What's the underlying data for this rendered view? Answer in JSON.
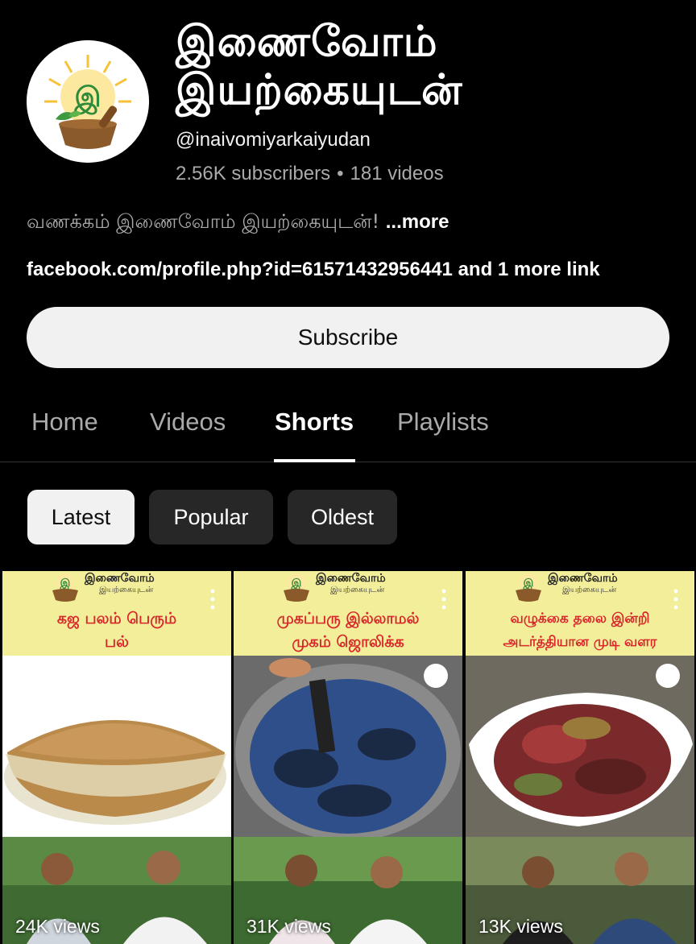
{
  "channel": {
    "name": "இணைவோம் இயற்கையுடன்",
    "handle": "@inaivomiyarkaiyudan",
    "subscribers": "2.56K subscribers",
    "videos": "181 videos",
    "separator": "•",
    "avatar_icon": "mortar-pestle-logo-icon"
  },
  "description": {
    "text": "வணக்கம்  இணைவோம் இயற்கையுடன்! ",
    "more": "...more"
  },
  "links": {
    "url": "facebook.com/profile.php?id=61571432956441",
    "more": " and 1 more link"
  },
  "subscribe": {
    "label": "Subscribe"
  },
  "tabs": [
    {
      "label": "Home"
    },
    {
      "label": "Videos"
    },
    {
      "label": "Shorts",
      "active": true
    },
    {
      "label": "Playlists"
    }
  ],
  "chips": [
    {
      "label": "Latest",
      "active": true
    },
    {
      "label": "Popular"
    },
    {
      "label": "Oldest"
    }
  ],
  "shorts": [
    {
      "title_line1": "கஜ பலம் பெரும்",
      "title_line2": "பல்",
      "views": "24K views",
      "photo": "spice-powder-bowl"
    },
    {
      "title_line1": "முகப்பரு இல்லாமல்",
      "title_line2": "முகம் ஜொலிக்க",
      "views": "31K views",
      "photo": "blue-liquid-pot"
    },
    {
      "title_line1": "வழுக்கை தலை இன்றி",
      "title_line2": "அடர்த்தியான முடி வளர",
      "views": "13K views",
      "photo": "dried-rose-petals"
    }
  ],
  "banner_brand": {
    "name": "இணைவோம்",
    "sub": "இயற்கையுடன்"
  },
  "colors": {
    "background": "#000000",
    "banner": "#f2ee9a",
    "title_red": "#d8262b",
    "chip": "#272727",
    "subscribe": "#f1f1f1"
  }
}
